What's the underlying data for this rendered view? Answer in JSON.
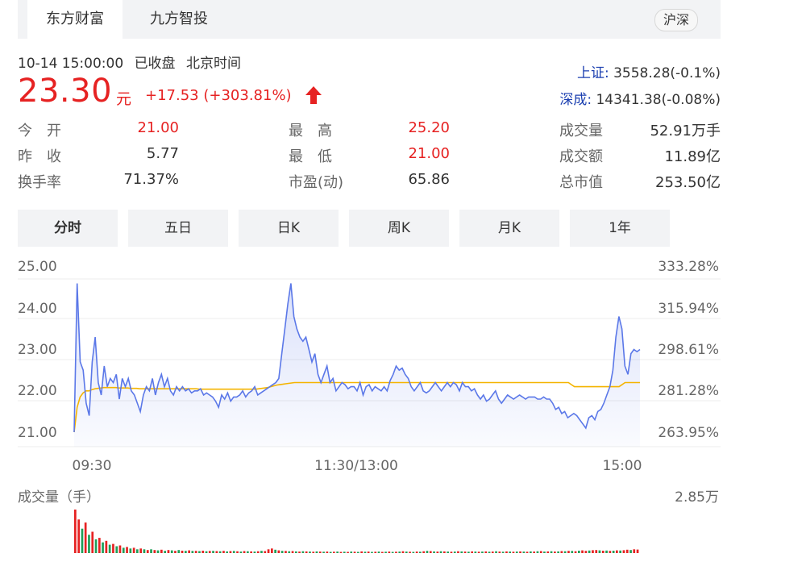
{
  "tabs": {
    "items": [
      {
        "label": "东方财富",
        "active": true
      },
      {
        "label": "九方智投",
        "active": false
      }
    ],
    "market_toggle": "沪深"
  },
  "quote": {
    "datetime": "10-14 15:00:00",
    "status": "已收盘",
    "timezone": "北京时间",
    "price": "23.30",
    "unit": "元",
    "change": "+17.53",
    "change_pct": "(+303.81%)",
    "direction": "up"
  },
  "indices": [
    {
      "name": "上证:",
      "value": "3558.28(-0.1%)"
    },
    {
      "name": "深成:",
      "value": "14341.38(-0.08%)"
    }
  ],
  "stats": {
    "open": {
      "label": "今　开",
      "value": "21.00"
    },
    "prev_close": {
      "label": "昨　收",
      "value": "5.77"
    },
    "turnover_rate": {
      "label": "换手率",
      "value": "71.37%"
    },
    "high": {
      "label": "最　高",
      "value": "25.20"
    },
    "low": {
      "label": "最　低",
      "value": "21.00"
    },
    "pe": {
      "label": "市盈(动)",
      "value": "65.86"
    },
    "volume": {
      "label": "成交量",
      "value": "52.91万手"
    },
    "amount": {
      "label": "成交额",
      "value": "11.89亿"
    },
    "market_cap": {
      "label": "总市值",
      "value": "253.50亿"
    }
  },
  "period_tabs": [
    {
      "label": "分时",
      "active": true
    },
    {
      "label": "五日",
      "active": false
    },
    {
      "label": "日K",
      "active": false
    },
    {
      "label": "周K",
      "active": false
    },
    {
      "label": "月K",
      "active": false
    },
    {
      "label": "1年",
      "active": false
    }
  ],
  "colors": {
    "up": "#e62222",
    "down": "#1fa05a",
    "price_line": "#5b78e8",
    "avg_line": "#f4b400",
    "index_link": "#1b3fb0"
  },
  "chart_data": {
    "type": "line",
    "price_ticks": [
      "25.00",
      "24.00",
      "23.00",
      "22.00",
      "21.00"
    ],
    "pct_ticks": [
      "333.28%",
      "315.94%",
      "298.61%",
      "281.28%",
      "263.95%"
    ],
    "ylim": [
      21.0,
      25.0
    ],
    "time_labels": [
      "09:30",
      "11:30/13:00",
      "15:00"
    ],
    "price_series": [
      21.0,
      24.6,
      22.7,
      22.5,
      21.7,
      21.4,
      22.7,
      23.3,
      22.2,
      21.9,
      22.6,
      22.1,
      22.3,
      22.2,
      22.4,
      21.8,
      22.3,
      22.1,
      22.3,
      22.0,
      21.9,
      21.7,
      21.5,
      21.9,
      22.1,
      22.0,
      22.3,
      21.9,
      22.2,
      22.4,
      22.1,
      22.3,
      22.0,
      21.9,
      22.1,
      22.0,
      22.1,
      22.0,
      22.05,
      21.95,
      22.0,
      22.0,
      22.05,
      21.9,
      21.95,
      21.9,
      21.85,
      21.75,
      21.6,
      21.9,
      21.8,
      21.95,
      21.75,
      21.85,
      21.85,
      21.9,
      22.0,
      21.85,
      21.95,
      22.0,
      22.1,
      21.9,
      21.95,
      22.0,
      22.05,
      22.1,
      22.15,
      22.2,
      22.3,
      22.9,
      23.5,
      24.1,
      24.6,
      23.8,
      23.5,
      23.3,
      23.2,
      23.3,
      23.0,
      22.7,
      22.9,
      22.4,
      22.2,
      22.4,
      22.6,
      22.2,
      22.3,
      22.0,
      22.1,
      22.2,
      22.15,
      22.05,
      22.1,
      22.1,
      22.0,
      22.2,
      21.9,
      22.1,
      22.15,
      22.0,
      22.1,
      22.05,
      22.0,
      22.1,
      22.0,
      22.25,
      22.4,
      22.6,
      22.5,
      22.55,
      22.4,
      22.3,
      22.1,
      22.0,
      22.1,
      22.2,
      22.0,
      21.95,
      22.0,
      22.1,
      22.2,
      22.1,
      22.0,
      22.1,
      22.2,
      22.1,
      22.2,
      22.15,
      22.0,
      22.2,
      22.1,
      22.1,
      22.0,
      22.05,
      21.9,
      21.8,
      21.9,
      21.75,
      21.8,
      21.9,
      22.0,
      21.8,
      21.7,
      21.8,
      21.9,
      21.85,
      21.8,
      21.85,
      21.9,
      21.85,
      21.8,
      21.85,
      21.85,
      21.85,
      21.8,
      21.8,
      21.85,
      21.8,
      21.8,
      21.7,
      21.55,
      21.6,
      21.45,
      21.5,
      21.35,
      21.4,
      21.45,
      21.4,
      21.3,
      21.2,
      21.1,
      21.35,
      21.4,
      21.3,
      21.5,
      21.55,
      21.7,
      21.9,
      22.1,
      22.5,
      23.3,
      23.8,
      23.5,
      22.6,
      22.4,
      22.9,
      23.0,
      22.95,
      23.0
    ],
    "avg_series": [
      21.0,
      21.6,
      21.85,
      21.95,
      22.0,
      22.0,
      22.03,
      22.05,
      22.06,
      22.07,
      22.08,
      22.08,
      22.08,
      22.08,
      22.08,
      22.07,
      22.07,
      22.07,
      22.07,
      22.06,
      22.06,
      22.06,
      22.05,
      22.05,
      22.05,
      22.05,
      22.05,
      22.05,
      22.05,
      22.05,
      22.05,
      22.05,
      22.05,
      22.05,
      22.05,
      22.05,
      22.05,
      22.05,
      22.05,
      22.05,
      22.05,
      22.05,
      22.04,
      22.04,
      22.04,
      22.04,
      22.04,
      22.04,
      22.04,
      22.04,
      22.04,
      22.04,
      22.04,
      22.04,
      22.04,
      22.04,
      22.04,
      22.04,
      22.04,
      22.04,
      22.04,
      22.04,
      22.05,
      22.06,
      22.07,
      22.08,
      22.1,
      22.12,
      22.14,
      22.15,
      22.16,
      22.17,
      22.18,
      22.19,
      22.2,
      22.2,
      22.2,
      22.2,
      22.2,
      22.2,
      22.2,
      22.2,
      22.2,
      22.2,
      22.2,
      22.2,
      22.2,
      22.2,
      22.2,
      22.2,
      22.2,
      22.2,
      22.2,
      22.2,
      22.2,
      22.2,
      22.2,
      22.2,
      22.2,
      22.2,
      22.2,
      22.2,
      22.2,
      22.2,
      22.2,
      22.2,
      22.2,
      22.2,
      22.2,
      22.2,
      22.2,
      22.2,
      22.2,
      22.2,
      22.2,
      22.2,
      22.2,
      22.2,
      22.2,
      22.2,
      22.2,
      22.2,
      22.2,
      22.2,
      22.2,
      22.2,
      22.2,
      22.2,
      22.2,
      22.2,
      22.2,
      22.2,
      22.2,
      22.2,
      22.2,
      22.2,
      22.2,
      22.2,
      22.2,
      22.2,
      22.2,
      22.2,
      22.2,
      22.2,
      22.2,
      22.2,
      22.2,
      22.2,
      22.2,
      22.2,
      22.2,
      22.2,
      22.2,
      22.2,
      22.2,
      22.2,
      22.2,
      22.2,
      22.2,
      22.2,
      22.2,
      22.2,
      22.2,
      22.2,
      22.2,
      22.2,
      22.2,
      22.15,
      22.1,
      22.1,
      22.1,
      22.1,
      22.1,
      22.1,
      22.1,
      22.1,
      22.1,
      22.1,
      22.1,
      22.1,
      22.1,
      22.1,
      22.1,
      22.1,
      22.15,
      22.2,
      22.2,
      22.2,
      22.2,
      22.2,
      22.2
    ],
    "volume_title": "成交量（手）",
    "volume_max_label": "2.85万",
    "volume_max": 28500,
    "volume_bars": [
      {
        "v": 28500,
        "d": "up"
      },
      {
        "v": 22000,
        "d": "up"
      },
      {
        "v": 16000,
        "d": "down"
      },
      {
        "v": 20000,
        "d": "up"
      },
      {
        "v": 12000,
        "d": "down"
      },
      {
        "v": 14000,
        "d": "up"
      },
      {
        "v": 9000,
        "d": "down"
      },
      {
        "v": 10000,
        "d": "up"
      },
      {
        "v": 7000,
        "d": "down"
      },
      {
        "v": 8000,
        "d": "up"
      },
      {
        "v": 5500,
        "d": "down"
      },
      {
        "v": 6000,
        "d": "up"
      },
      {
        "v": 4500,
        "d": "down"
      },
      {
        "v": 5000,
        "d": "up"
      },
      {
        "v": 3500,
        "d": "down"
      },
      {
        "v": 4000,
        "d": "up"
      },
      {
        "v": 3000,
        "d": "down"
      },
      {
        "v": 3500,
        "d": "up"
      },
      {
        "v": 2500,
        "d": "down"
      },
      {
        "v": 3000,
        "d": "up"
      },
      {
        "v": 2500,
        "d": "down"
      },
      {
        "v": 2000,
        "d": "up"
      },
      {
        "v": 2500,
        "d": "down"
      },
      {
        "v": 2000,
        "d": "up"
      },
      {
        "v": 1800,
        "d": "down"
      },
      {
        "v": 2200,
        "d": "up"
      },
      {
        "v": 1500,
        "d": "down"
      },
      {
        "v": 2000,
        "d": "up"
      },
      {
        "v": 1800,
        "d": "down"
      },
      {
        "v": 1500,
        "d": "up"
      },
      {
        "v": 2000,
        "d": "down"
      },
      {
        "v": 1600,
        "d": "up"
      },
      {
        "v": 1500,
        "d": "down"
      },
      {
        "v": 1800,
        "d": "up"
      },
      {
        "v": 1400,
        "d": "down"
      },
      {
        "v": 1500,
        "d": "up"
      },
      {
        "v": 1300,
        "d": "down"
      },
      {
        "v": 1600,
        "d": "up"
      },
      {
        "v": 1200,
        "d": "down"
      },
      {
        "v": 1400,
        "d": "up"
      },
      {
        "v": 1500,
        "d": "down"
      },
      {
        "v": 1300,
        "d": "up"
      },
      {
        "v": 1200,
        "d": "down"
      },
      {
        "v": 1500,
        "d": "up"
      },
      {
        "v": 1100,
        "d": "down"
      },
      {
        "v": 1300,
        "d": "up"
      },
      {
        "v": 1400,
        "d": "down"
      },
      {
        "v": 1200,
        "d": "up"
      },
      {
        "v": 1000,
        "d": "down"
      },
      {
        "v": 1300,
        "d": "up"
      },
      {
        "v": 1200,
        "d": "down"
      },
      {
        "v": 1100,
        "d": "up"
      },
      {
        "v": 1000,
        "d": "down"
      },
      {
        "v": 1200,
        "d": "up"
      },
      {
        "v": 1500,
        "d": "down"
      },
      {
        "v": 1300,
        "d": "up"
      },
      {
        "v": 2500,
        "d": "up"
      },
      {
        "v": 3000,
        "d": "up"
      },
      {
        "v": 2200,
        "d": "down"
      },
      {
        "v": 1800,
        "d": "up"
      },
      {
        "v": 1500,
        "d": "down"
      },
      {
        "v": 1400,
        "d": "up"
      },
      {
        "v": 1200,
        "d": "down"
      },
      {
        "v": 1300,
        "d": "up"
      },
      {
        "v": 1100,
        "d": "down"
      },
      {
        "v": 1000,
        "d": "up"
      },
      {
        "v": 1200,
        "d": "down"
      },
      {
        "v": 1100,
        "d": "up"
      },
      {
        "v": 1000,
        "d": "down"
      },
      {
        "v": 900,
        "d": "up"
      },
      {
        "v": 1100,
        "d": "down"
      },
      {
        "v": 1000,
        "d": "up"
      },
      {
        "v": 900,
        "d": "down"
      },
      {
        "v": 1000,
        "d": "up"
      },
      {
        "v": 800,
        "d": "down"
      },
      {
        "v": 900,
        "d": "up"
      },
      {
        "v": 1000,
        "d": "down"
      },
      {
        "v": 800,
        "d": "up"
      },
      {
        "v": 900,
        "d": "down"
      },
      {
        "v": 800,
        "d": "up"
      },
      {
        "v": 1000,
        "d": "down"
      },
      {
        "v": 900,
        "d": "up"
      },
      {
        "v": 800,
        "d": "down"
      },
      {
        "v": 1100,
        "d": "up"
      },
      {
        "v": 900,
        "d": "down"
      },
      {
        "v": 1000,
        "d": "up"
      },
      {
        "v": 800,
        "d": "down"
      },
      {
        "v": 900,
        "d": "up"
      },
      {
        "v": 1000,
        "d": "down"
      },
      {
        "v": 800,
        "d": "up"
      },
      {
        "v": 900,
        "d": "down"
      },
      {
        "v": 1000,
        "d": "up"
      },
      {
        "v": 800,
        "d": "down"
      },
      {
        "v": 900,
        "d": "up"
      },
      {
        "v": 1000,
        "d": "down"
      },
      {
        "v": 1200,
        "d": "up"
      },
      {
        "v": 1000,
        "d": "down"
      },
      {
        "v": 900,
        "d": "up"
      },
      {
        "v": 800,
        "d": "down"
      },
      {
        "v": 1000,
        "d": "up"
      },
      {
        "v": 900,
        "d": "down"
      },
      {
        "v": 1200,
        "d": "up"
      },
      {
        "v": 1500,
        "d": "down"
      },
      {
        "v": 1300,
        "d": "up"
      },
      {
        "v": 1100,
        "d": "down"
      },
      {
        "v": 1000,
        "d": "up"
      },
      {
        "v": 1200,
        "d": "down"
      },
      {
        "v": 1100,
        "d": "up"
      },
      {
        "v": 1000,
        "d": "down"
      },
      {
        "v": 900,
        "d": "up"
      },
      {
        "v": 1000,
        "d": "down"
      },
      {
        "v": 1200,
        "d": "up"
      },
      {
        "v": 1100,
        "d": "down"
      },
      {
        "v": 1000,
        "d": "up"
      },
      {
        "v": 900,
        "d": "down"
      },
      {
        "v": 1100,
        "d": "up"
      },
      {
        "v": 1000,
        "d": "down"
      },
      {
        "v": 900,
        "d": "up"
      },
      {
        "v": 1000,
        "d": "down"
      },
      {
        "v": 1100,
        "d": "up"
      },
      {
        "v": 900,
        "d": "down"
      },
      {
        "v": 1000,
        "d": "up"
      },
      {
        "v": 1200,
        "d": "down"
      },
      {
        "v": 1000,
        "d": "up"
      },
      {
        "v": 900,
        "d": "down"
      },
      {
        "v": 1100,
        "d": "up"
      },
      {
        "v": 1000,
        "d": "down"
      },
      {
        "v": 900,
        "d": "up"
      },
      {
        "v": 1000,
        "d": "down"
      },
      {
        "v": 1100,
        "d": "up"
      },
      {
        "v": 1000,
        "d": "down"
      },
      {
        "v": 900,
        "d": "up"
      },
      {
        "v": 1100,
        "d": "down"
      },
      {
        "v": 1000,
        "d": "up"
      },
      {
        "v": 1200,
        "d": "down"
      },
      {
        "v": 1300,
        "d": "up"
      },
      {
        "v": 1000,
        "d": "down"
      },
      {
        "v": 1100,
        "d": "up"
      },
      {
        "v": 1200,
        "d": "down"
      },
      {
        "v": 1000,
        "d": "up"
      },
      {
        "v": 1100,
        "d": "down"
      },
      {
        "v": 1300,
        "d": "up"
      },
      {
        "v": 1200,
        "d": "down"
      },
      {
        "v": 1500,
        "d": "up"
      },
      {
        "v": 1400,
        "d": "down"
      },
      {
        "v": 1200,
        "d": "up"
      },
      {
        "v": 1600,
        "d": "down"
      },
      {
        "v": 1800,
        "d": "up"
      },
      {
        "v": 1500,
        "d": "up"
      },
      {
        "v": 1700,
        "d": "down"
      },
      {
        "v": 1900,
        "d": "up"
      },
      {
        "v": 2000,
        "d": "up"
      },
      {
        "v": 1800,
        "d": "down"
      },
      {
        "v": 1600,
        "d": "up"
      },
      {
        "v": 1700,
        "d": "down"
      },
      {
        "v": 1500,
        "d": "up"
      },
      {
        "v": 1600,
        "d": "down"
      },
      {
        "v": 1800,
        "d": "up"
      },
      {
        "v": 1700,
        "d": "down"
      },
      {
        "v": 1900,
        "d": "up"
      },
      {
        "v": 2200,
        "d": "up"
      },
      {
        "v": 2000,
        "d": "down"
      },
      {
        "v": 2500,
        "d": "up"
      },
      {
        "v": 2300,
        "d": "up"
      }
    ]
  }
}
